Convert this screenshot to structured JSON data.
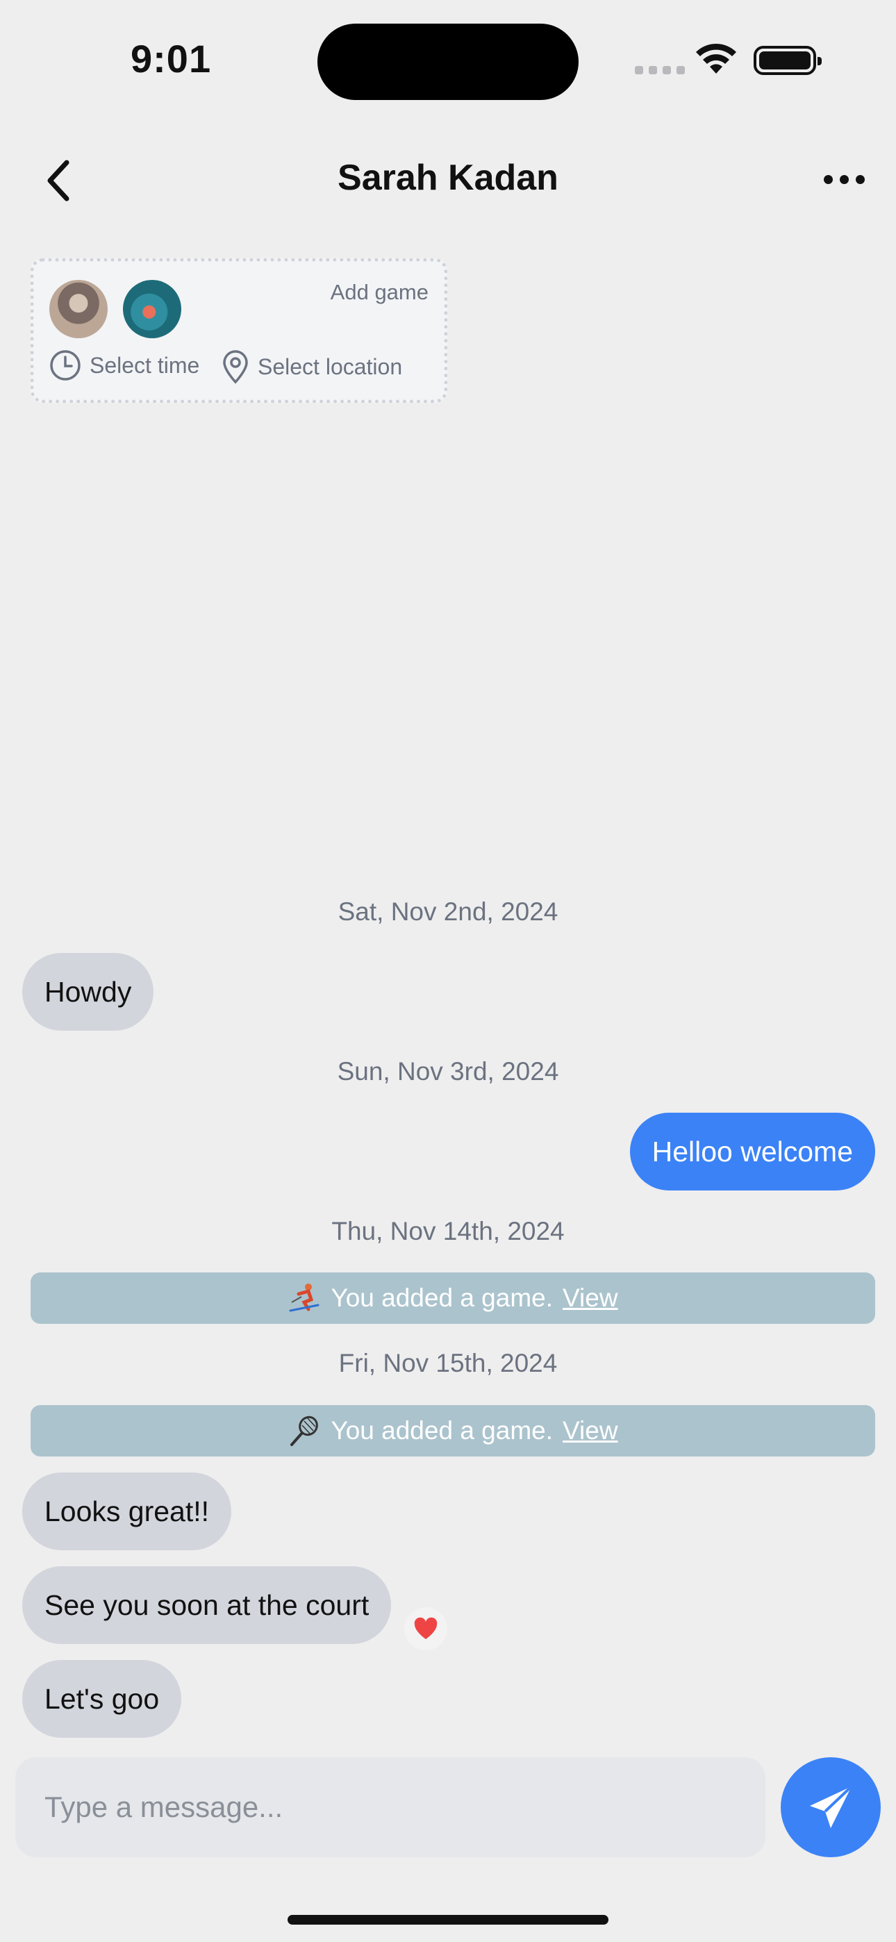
{
  "status": {
    "time": "9:01"
  },
  "header": {
    "title": "Sarah Kadan",
    "back_icon": "chevron-left-icon",
    "more_icon": "ellipsis-icon"
  },
  "game_card": {
    "add_label": "Add game",
    "time_label": "Select time",
    "location_label": "Select location"
  },
  "messages": {
    "date1": "Sat, Nov 2nd, 2024",
    "m1": "Howdy",
    "date2": "Sun, Nov 3rd, 2024",
    "m2": "Helloo welcome",
    "date3": "Thu, Nov 14th, 2024",
    "sys1_text": "You added a game.",
    "sys1_link": "View",
    "sys1_icon": "skier-icon",
    "date4": "Fri, Nov 15th, 2024",
    "sys2_text": "You added a game.",
    "sys2_link": "View",
    "sys2_icon": "tennis-racket-icon",
    "m3": "Looks great!!",
    "m4": "See you soon at the court",
    "m4_reaction": "❤️",
    "m5": "Let's goo"
  },
  "composer": {
    "placeholder": "Type a message...",
    "send_icon": "paper-plane-icon"
  },
  "colors": {
    "accent": "#3b82f6",
    "incoming": "#d2d5dc",
    "system": "#abc3cd",
    "background": "#eeeeee"
  }
}
